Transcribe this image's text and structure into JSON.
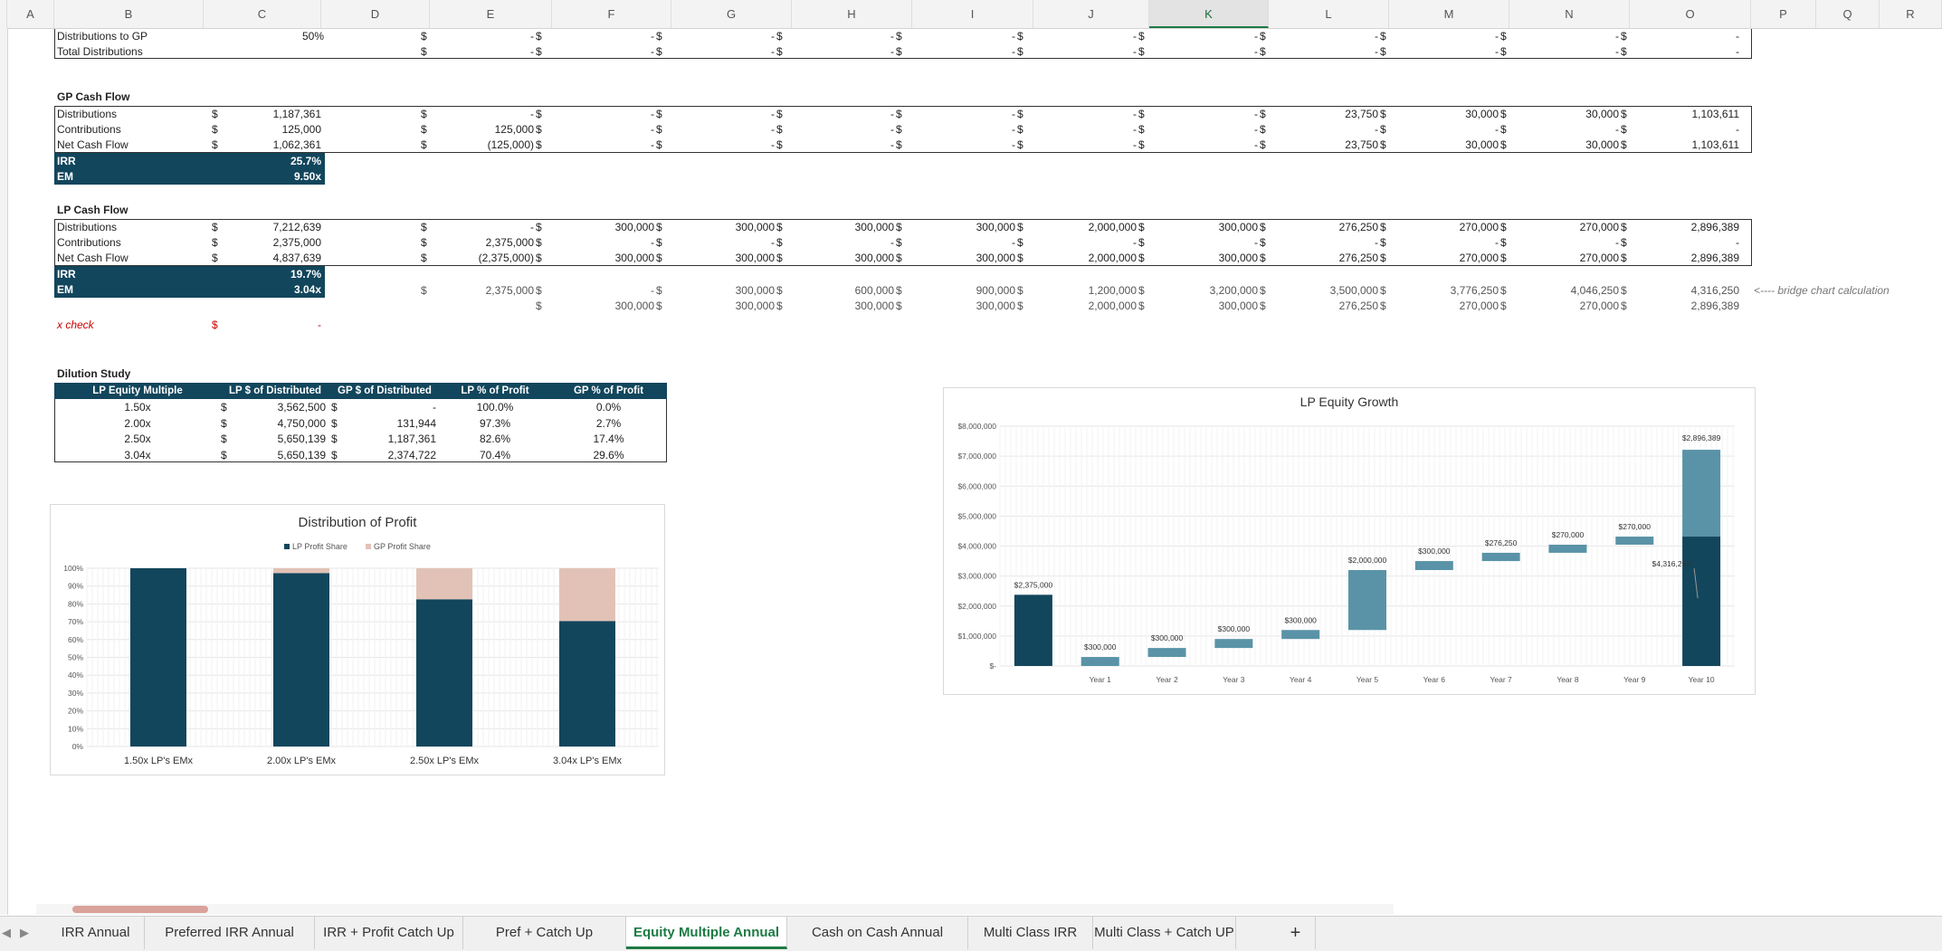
{
  "columns": [
    "A",
    "B",
    "C",
    "D",
    "E",
    "F",
    "G",
    "H",
    "I",
    "J",
    "K",
    "L",
    "M",
    "N",
    "O",
    "P",
    "Q",
    "R"
  ],
  "selected_column": "K",
  "top_rows": [
    {
      "label": "Distributions to GP",
      "c": "50%",
      "vals": [
        "-",
        "-",
        "-",
        "-",
        "-",
        "-",
        "-",
        "-",
        "-",
        "-",
        "-"
      ]
    },
    {
      "label": "Total Distributions",
      "c": "",
      "vals": [
        "-",
        "-",
        "-",
        "-",
        "-",
        "-",
        "-",
        "-",
        "-",
        "-",
        "-"
      ]
    }
  ],
  "gp": {
    "title": "GP Cash Flow",
    "rows": [
      {
        "label": "Distributions",
        "c": "1,187,361",
        "vals": [
          "-",
          "-",
          "-",
          "-",
          "-",
          "-",
          "-",
          "23,750",
          "30,000",
          "30,000",
          "1,103,611"
        ]
      },
      {
        "label": "Contributions",
        "c": "125,000",
        "vals": [
          "125,000",
          "-",
          "-",
          "-",
          "-",
          "-",
          "-",
          "-",
          "-",
          "-",
          "-"
        ]
      },
      {
        "label": "Net Cash Flow",
        "c": "1,062,361",
        "vals": [
          "(125,000)",
          "-",
          "-",
          "-",
          "-",
          "-",
          "-",
          "23,750",
          "30,000",
          "30,000",
          "1,103,611"
        ]
      }
    ],
    "irr_label": "IRR",
    "irr": "25.7%",
    "em_label": "EM",
    "em": "9.50x"
  },
  "lp": {
    "title": "LP Cash Flow",
    "rows": [
      {
        "label": "Distributions",
        "c": "7,212,639",
        "vals": [
          "-",
          "300,000",
          "300,000",
          "300,000",
          "300,000",
          "2,000,000",
          "300,000",
          "276,250",
          "270,000",
          "270,000",
          "2,896,389"
        ]
      },
      {
        "label": "Contributions",
        "c": "2,375,000",
        "vals": [
          "2,375,000",
          "-",
          "-",
          "-",
          "-",
          "-",
          "-",
          "-",
          "-",
          "-",
          "-"
        ]
      },
      {
        "label": "Net Cash Flow",
        "c": "4,837,639",
        "vals": [
          "(2,375,000)",
          "300,000",
          "300,000",
          "300,000",
          "300,000",
          "2,000,000",
          "300,000",
          "276,250",
          "270,000",
          "270,000",
          "2,896,389"
        ]
      }
    ],
    "irr_label": "IRR",
    "irr": "19.7%",
    "em_label": "EM",
    "em": "3.04x",
    "bridge_row1": [
      "2,375,000",
      "-",
      "300,000",
      "600,000",
      "900,000",
      "1,200,000",
      "3,200,000",
      "3,500,000",
      "3,776,250",
      "4,046,250",
      "4,316,250"
    ],
    "bridge_row2": [
      "",
      "300,000",
      "300,000",
      "300,000",
      "300,000",
      "2,000,000",
      "300,000",
      "276,250",
      "270,000",
      "270,000",
      "2,896,389"
    ],
    "bridge_note": "<---- bridge chart calculation"
  },
  "xcheck": {
    "label": "x check",
    "dollar": "$",
    "value": "-"
  },
  "dilution": {
    "title": "Dilution Study",
    "headers": [
      "LP Equity Multiple",
      "LP $ of Distributed",
      "GP $ of Distributed",
      "LP % of Profit",
      "GP % of Profit"
    ],
    "rows": [
      [
        "1.50x",
        "3,562,500",
        "-",
        "100.0%",
        "0.0%"
      ],
      [
        "2.00x",
        "4,750,000",
        "131,944",
        "97.3%",
        "2.7%"
      ],
      [
        "2.50x",
        "5,650,139",
        "1,187,361",
        "82.6%",
        "17.4%"
      ],
      [
        "3.04x",
        "5,650,139",
        "2,374,722",
        "70.4%",
        "29.6%"
      ]
    ]
  },
  "dist_chart": {
    "title": "Distribution of Profit",
    "legend": [
      "LP Profit Share",
      "GP Profit Share"
    ],
    "y_ticks": [
      "0%",
      "10%",
      "20%",
      "30%",
      "40%",
      "50%",
      "60%",
      "70%",
      "80%",
      "90%",
      "100%"
    ],
    "colors": {
      "lp": "#12465c",
      "gp": "#e2c2b6"
    }
  },
  "lp_chart": {
    "title": "LP Equity Growth",
    "y_ticks": [
      "$-",
      "$1,000,000",
      "$2,000,000",
      "$3,000,000",
      "$4,000,000",
      "$5,000,000",
      "$6,000,000",
      "$7,000,000",
      "$8,000,000"
    ],
    "colors": {
      "base": "#12465c",
      "step": "#5a93a7"
    }
  },
  "chart_data": [
    {
      "type": "bar",
      "title": "Distribution of Profit",
      "categories": [
        "1.50x  LP's EMx",
        "2.00x  LP's EMx",
        "2.50x  LP's EMx",
        "3.04x  LP's EMx"
      ],
      "series": [
        {
          "name": "LP Profit Share",
          "values": [
            100.0,
            97.3,
            82.6,
            70.4
          ]
        },
        {
          "name": "GP Profit Share",
          "values": [
            0.0,
            2.7,
            17.4,
            29.6
          ]
        }
      ],
      "stacked": true,
      "ylim": [
        0,
        100
      ],
      "legend": "top"
    },
    {
      "type": "bar",
      "title": "LP Equity Growth",
      "categories": [
        "",
        "Year 1",
        "Year 2",
        "Year 3",
        "Year 4",
        "Year 5",
        "Year 6",
        "Year 7",
        "Year 8",
        "Year 9",
        "Year 10"
      ],
      "base": [
        0,
        0,
        300000,
        600000,
        900000,
        1200000,
        3200000,
        3500000,
        3776250,
        4046250,
        0
      ],
      "values": [
        2375000,
        300000,
        300000,
        300000,
        300000,
        2000000,
        300000,
        276250,
        270000,
        270000,
        2896389
      ],
      "data_labels": [
        "$2,375,000",
        "$300,000",
        "$300,000",
        "$300,000",
        "$300,000",
        "$2,000,000",
        "$300,000",
        "$276,250",
        "$270,000",
        "$270,000",
        "$2,896,389"
      ],
      "final_base": 4316250,
      "final_base_label": "$4,316,250",
      "ylim": [
        0,
        8000000
      ]
    }
  ],
  "tabs": [
    "IRR Annual",
    "Preferred IRR Annual",
    "IRR + Profit Catch Up",
    "Pref + Catch Up",
    "Equity Multiple Annual",
    "Cash on Cash Annual",
    "Multi Class IRR",
    "Multi Class + Catch UP"
  ],
  "active_tab": "Equity Multiple Annual",
  "dollar": "$"
}
